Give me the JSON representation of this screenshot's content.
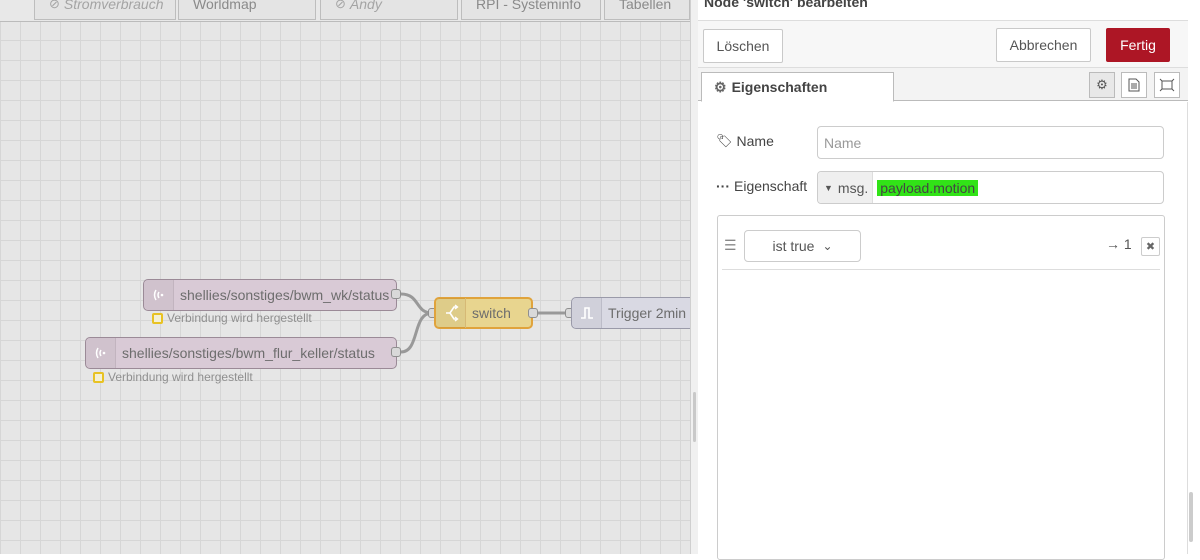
{
  "workspace_tabs": [
    {
      "label": "Stromverbrauch",
      "disabled": true
    },
    {
      "label": "Worldmap",
      "disabled": false
    },
    {
      "label": "Andy",
      "disabled": true
    },
    {
      "label": "RPI - Systeminfo",
      "disabled": false
    },
    {
      "label": "Tabellen",
      "disabled": false
    }
  ],
  "nodes": {
    "mqtt1": {
      "label": "shellies/sonstiges/bwm_wk/status",
      "status": "Verbindung wird hergestellt",
      "icon": "mqtt-antenna-icon"
    },
    "mqtt2": {
      "label": "shellies/sonstiges/bwm_flur_keller/status",
      "status": "Verbindung wird hergestellt",
      "icon": "mqtt-antenna-icon"
    },
    "switch": {
      "label": "switch",
      "icon": "switch-icon"
    },
    "trigger": {
      "label": "Trigger 2min",
      "icon": "trigger-pulse-icon"
    }
  },
  "tray": {
    "title": "Node 'switch' bearbeiten",
    "delete_label": "Löschen",
    "cancel_label": "Abbrechen",
    "done_label": "Fertig",
    "tab_label": "Eigenschaften"
  },
  "form": {
    "name_label": "Name",
    "name_placeholder": "Name",
    "name_value": "",
    "property_label": "Eigenschaft",
    "property_type": "msg.",
    "property_value": "payload.motion"
  },
  "rule": {
    "operator": "ist true",
    "output_arrow": "→",
    "output_number": "1",
    "remove_label": "✖"
  },
  "colors": {
    "accent_red": "#ad1625",
    "switch_node": "#e8d58f",
    "mqtt_node": "#d9cad6",
    "highlight_green": "#31e317"
  }
}
